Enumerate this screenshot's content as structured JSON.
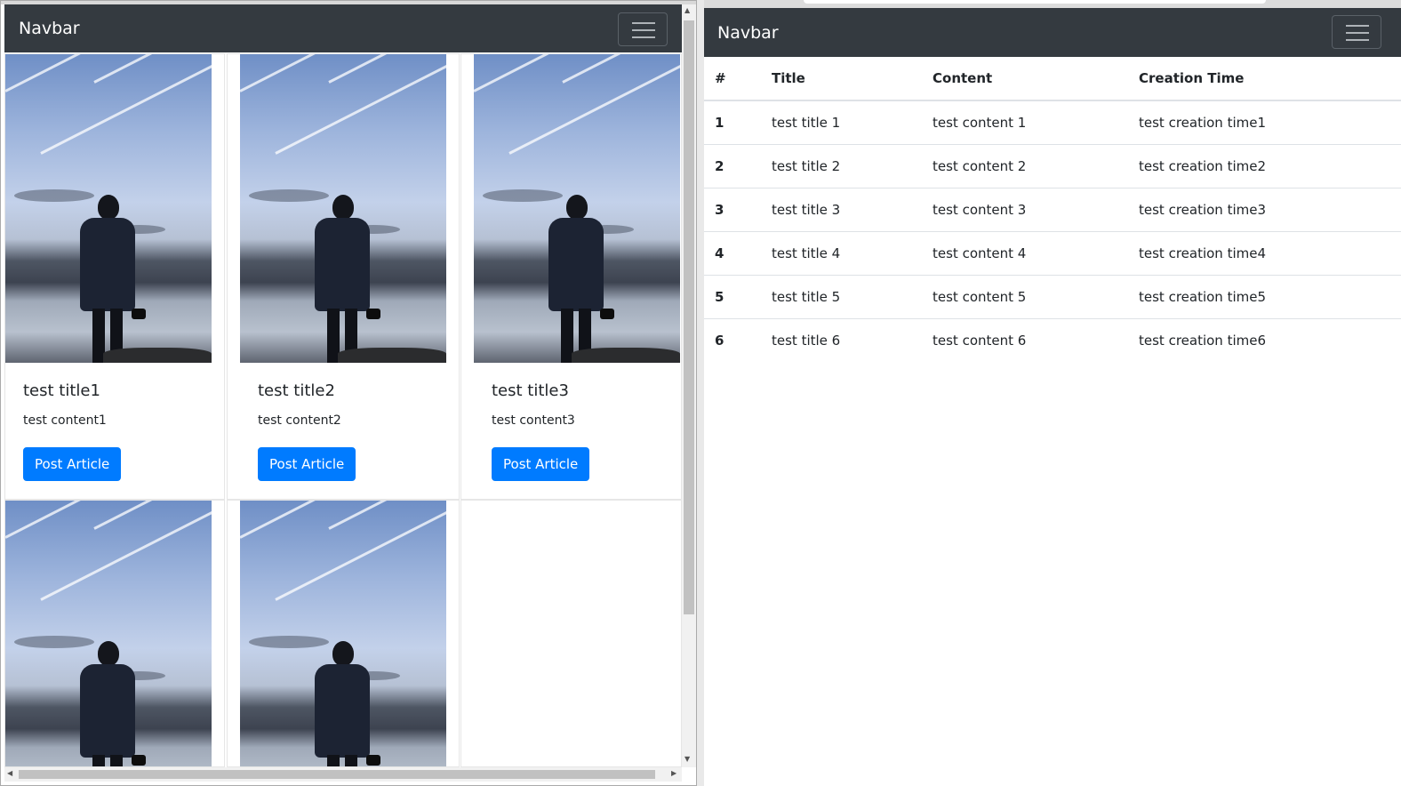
{
  "left_window": {
    "navbar": {
      "brand": "Navbar",
      "toggler_icon": "hamburger-icon"
    },
    "cards": [
      {
        "title": "test title1",
        "content": "test content1",
        "button": "Post Article"
      },
      {
        "title": "test title2",
        "content": "test content2",
        "button": "Post Article"
      },
      {
        "title": "test title3",
        "content": "test content3",
        "button": "Post Article"
      }
    ],
    "card_image": "person-at-lake-photo",
    "colors": {
      "navbar_bg": "#343a40",
      "button_bg": "#007bff"
    }
  },
  "right_window": {
    "navbar": {
      "brand": "Navbar",
      "toggler_icon": "hamburger-icon"
    },
    "table": {
      "headers": [
        "#",
        "Title",
        "Content",
        "Creation Time"
      ],
      "rows": [
        [
          "1",
          "test title 1",
          "test content 1",
          "test creation time1"
        ],
        [
          "2",
          "test title 2",
          "test content 2",
          "test creation time2"
        ],
        [
          "3",
          "test title 3",
          "test content 3",
          "test creation time3"
        ],
        [
          "4",
          "test title 4",
          "test content 4",
          "test creation time4"
        ],
        [
          "5",
          "test title 5",
          "test content 5",
          "test creation time5"
        ],
        [
          "6",
          "test title 6",
          "test content 6",
          "test creation time6"
        ]
      ]
    }
  }
}
